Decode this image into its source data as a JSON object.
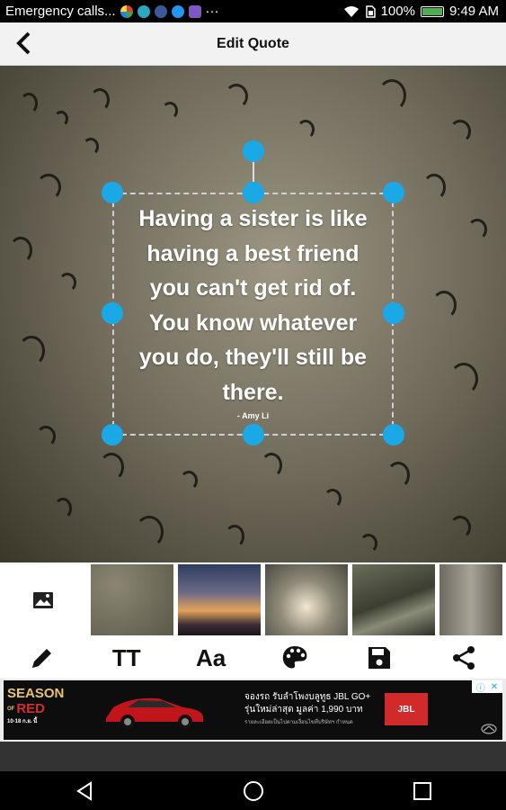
{
  "status_bar": {
    "notification_text": "Emergency calls...",
    "battery_percent": "100%",
    "time": "9:49 AM",
    "overflow": "···",
    "colors": {
      "bg": "#000000",
      "fg": "#ffffff",
      "battery": "#4caf50"
    }
  },
  "app_bar": {
    "title": "Edit Quote",
    "back_icon": "arrow-back-icon"
  },
  "quote": {
    "text_lines": [
      "Having a sister is like",
      "having a best friend",
      "you can't get rid of.",
      "You know whatever",
      "you do, they'll still be",
      "there."
    ],
    "author": "- Amy Li",
    "handle_color": "#1aa8e6"
  },
  "thumbnails": {
    "add_icon": "image-icon",
    "items": [
      "raindrops",
      "sunset-sky",
      "clouds-sky",
      "road-landscape",
      "stone-texture"
    ]
  },
  "toolbar": {
    "tools": [
      {
        "name": "edit",
        "icon": "pencil-icon"
      },
      {
        "name": "text-size",
        "label": "TT",
        "icon": "text-size-icon"
      },
      {
        "name": "font",
        "label": "Aa",
        "icon": "font-icon"
      },
      {
        "name": "color",
        "icon": "palette-icon"
      },
      {
        "name": "save",
        "icon": "save-icon"
      },
      {
        "name": "share",
        "icon": "share-icon"
      }
    ]
  },
  "ad": {
    "season_line1": "SEASON",
    "season_line2": "OF",
    "season_line3": "RED",
    "dates": "10-18 ก.ย. นี้",
    "headline": "จองรถ รับลำโพงบลูทูธ JBL GO+",
    "subline": "รุ่นใหม่ล่าสุด มูลค่า 1,990 บาท",
    "fineprint": "รายละเอียดเป็นไปตามเงื่อนไขที่บริษัทฯ กำหนด",
    "brand_box": "JBL",
    "info_icon": "info-icon",
    "close_icon": "close-icon"
  },
  "nav_bar": {
    "back_icon": "nav-back-icon",
    "home_icon": "nav-home-icon",
    "recents_icon": "nav-recents-icon"
  }
}
